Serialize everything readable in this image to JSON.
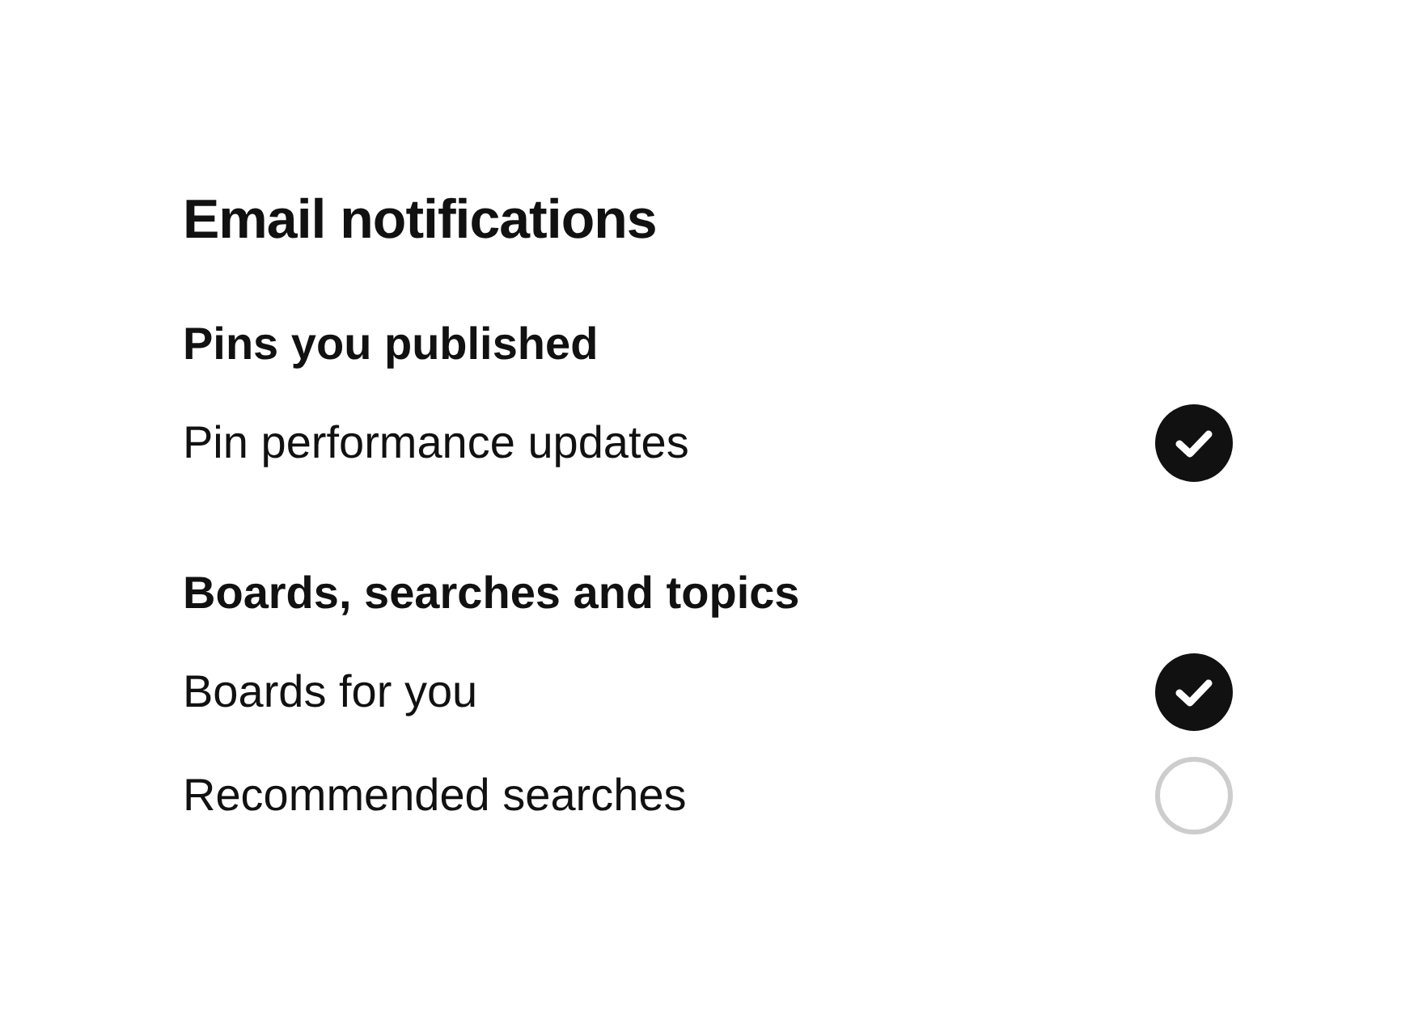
{
  "title": "Email notifications",
  "sections": [
    {
      "heading": "Pins you published",
      "items": [
        {
          "label": "Pin performance updates",
          "checked": true
        }
      ]
    },
    {
      "heading": "Boards, searches and topics",
      "items": [
        {
          "label": "Boards for you",
          "checked": true
        },
        {
          "label": "Recommended searches",
          "checked": false
        }
      ]
    }
  ]
}
